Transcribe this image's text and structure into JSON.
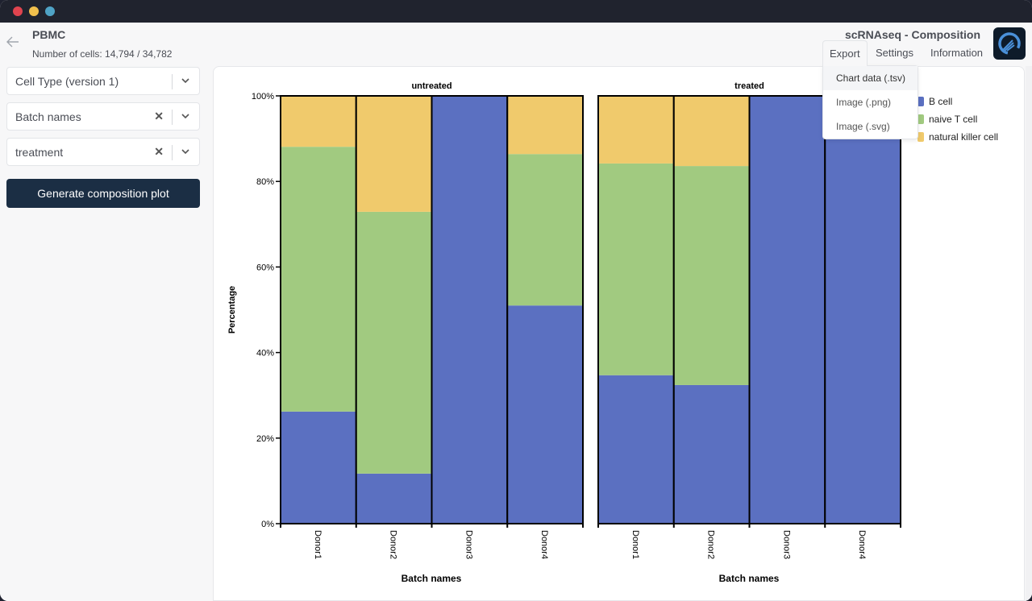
{
  "window": {
    "controls": [
      "close",
      "minimize",
      "zoom"
    ]
  },
  "header": {
    "dataset_title": "PBMC",
    "cell_count": "Number of cells: 14,794 / 34,782",
    "app_title": "scRNAseq - Composition",
    "back_icon": "arrow-left-icon",
    "logo_icon": "app-logo-icon"
  },
  "menu": {
    "items": [
      {
        "label": "Export",
        "active": true
      },
      {
        "label": "Settings"
      },
      {
        "label": "Information"
      }
    ],
    "export_dropdown": [
      {
        "label": "Chart data (.tsv)",
        "hovered": true
      },
      {
        "label": "Image (.png)"
      },
      {
        "label": "Image (.svg)"
      }
    ]
  },
  "sidebar": {
    "selects": [
      {
        "value": "Cell Type (version 1)",
        "clearable": false
      },
      {
        "value": "Batch names",
        "clearable": true
      },
      {
        "value": "treatment",
        "clearable": true
      }
    ],
    "clear_glyph": "✕",
    "generate_button": "Generate composition plot"
  },
  "chart_data": {
    "type": "bar",
    "stacked": true,
    "normalized": true,
    "facets": [
      {
        "title": "untreated",
        "categories": [
          "Donor1",
          "Donor2",
          "Donor3",
          "Donor4"
        ],
        "series": [
          {
            "name": "B cell",
            "values": [
              26.2,
              11.7,
              100.0,
              51.0
            ]
          },
          {
            "name": "naive T cell",
            "values": [
              61.9,
              61.2,
              0.0,
              35.4
            ]
          },
          {
            "name": "natural killer cell",
            "values": [
              11.9,
              27.1,
              0.0,
              13.6
            ]
          }
        ]
      },
      {
        "title": "treated",
        "categories": [
          "Donor1",
          "Donor2",
          "Donor3",
          "Donor4"
        ],
        "series": [
          {
            "name": "B cell",
            "values": [
              34.7,
              32.4,
              100.0,
              100.0
            ]
          },
          {
            "name": "naive T cell",
            "values": [
              49.5,
              51.2,
              0.0,
              0.0
            ]
          },
          {
            "name": "natural killer cell",
            "values": [
              15.8,
              16.4,
              0.0,
              0.0
            ]
          }
        ]
      }
    ],
    "xlabel": "Batch names",
    "ylabel": "Percentage",
    "ylim": [
      0,
      100
    ],
    "yticks": [
      0,
      20,
      40,
      60,
      80,
      100
    ],
    "ytick_labels": [
      "0%",
      "20%",
      "40%",
      "60%",
      "80%",
      "100%"
    ],
    "legend": {
      "placement": "right",
      "entries": [
        {
          "name": "B cell",
          "color": "#5b70c1"
        },
        {
          "name": "naive T cell",
          "color": "#a1ca80"
        },
        {
          "name": "natural killer cell",
          "color": "#f0ca6c"
        }
      ]
    },
    "grid": false
  }
}
